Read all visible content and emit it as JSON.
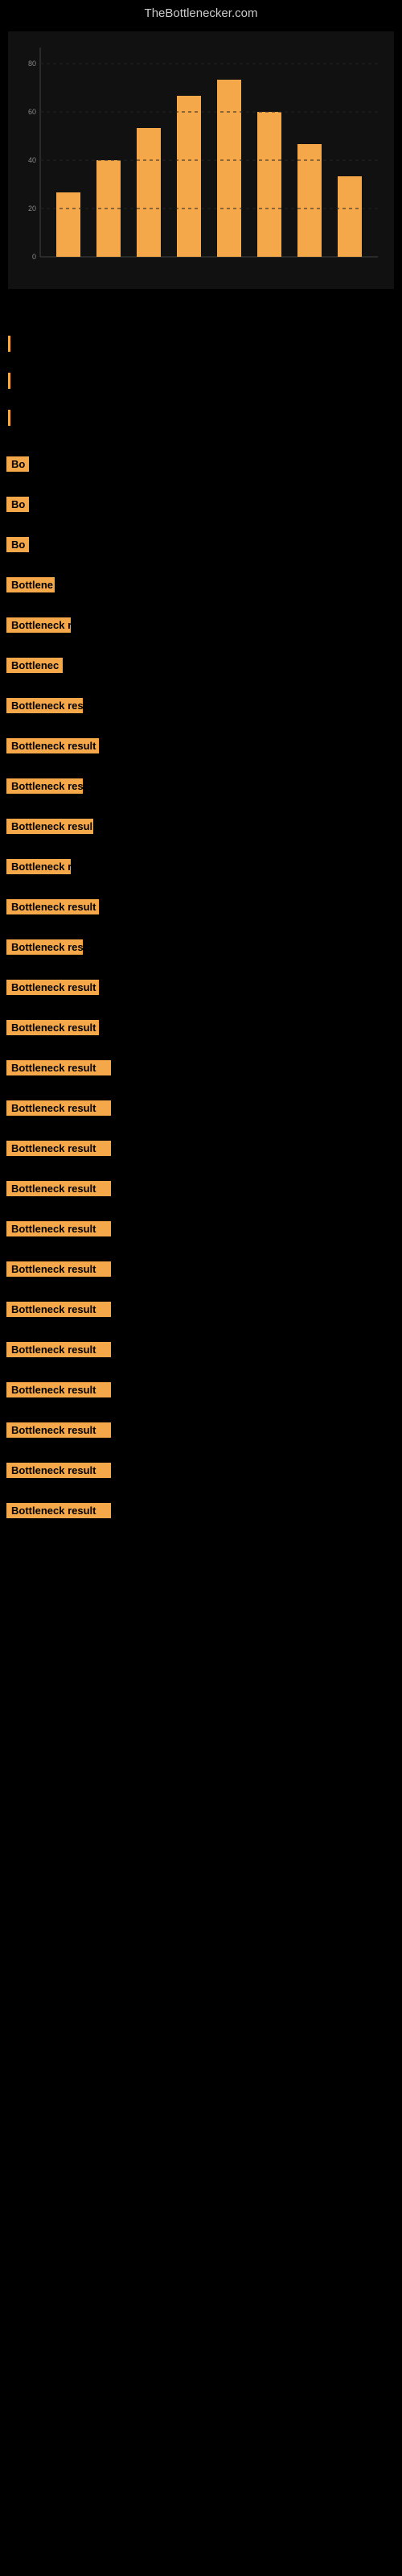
{
  "site": {
    "title": "TheBottlenecker.com"
  },
  "chart": {
    "has_bar_chart": true
  },
  "results": [
    {
      "id": 1,
      "label": "Bo",
      "width": 28
    },
    {
      "id": 2,
      "label": "Bo",
      "width": 28
    },
    {
      "id": 3,
      "label": "Bo",
      "width": 28
    },
    {
      "id": 4,
      "label": "Bottlene",
      "width": 60
    },
    {
      "id": 5,
      "label": "Bottleneck r",
      "width": 80
    },
    {
      "id": 6,
      "label": "Bottlenec",
      "width": 70
    },
    {
      "id": 7,
      "label": "Bottleneck res",
      "width": 95
    },
    {
      "id": 8,
      "label": "Bottleneck result",
      "width": 115
    },
    {
      "id": 9,
      "label": "Bottleneck res",
      "width": 95
    },
    {
      "id": 10,
      "label": "Bottleneck resul",
      "width": 108
    },
    {
      "id": 11,
      "label": "Bottleneck r",
      "width": 80
    },
    {
      "id": 12,
      "label": "Bottleneck result",
      "width": 115
    },
    {
      "id": 13,
      "label": "Bottleneck res",
      "width": 95
    },
    {
      "id": 14,
      "label": "Bottleneck result",
      "width": 115
    },
    {
      "id": 15,
      "label": "Bottleneck result",
      "width": 115
    },
    {
      "id": 16,
      "label": "Bottleneck result",
      "width": 130
    },
    {
      "id": 17,
      "label": "Bottleneck result",
      "width": 130
    },
    {
      "id": 18,
      "label": "Bottleneck result",
      "width": 130
    },
    {
      "id": 19,
      "label": "Bottleneck result",
      "width": 130
    },
    {
      "id": 20,
      "label": "Bottleneck result",
      "width": 130
    },
    {
      "id": 21,
      "label": "Bottleneck result",
      "width": 130
    },
    {
      "id": 22,
      "label": "Bottleneck result",
      "width": 130
    },
    {
      "id": 23,
      "label": "Bottleneck result",
      "width": 130
    },
    {
      "id": 24,
      "label": "Bottleneck result",
      "width": 130
    },
    {
      "id": 25,
      "label": "Bottleneck result",
      "width": 130
    },
    {
      "id": 26,
      "label": "Bottleneck result",
      "width": 130
    },
    {
      "id": 27,
      "label": "Bottleneck result",
      "width": 130
    }
  ]
}
